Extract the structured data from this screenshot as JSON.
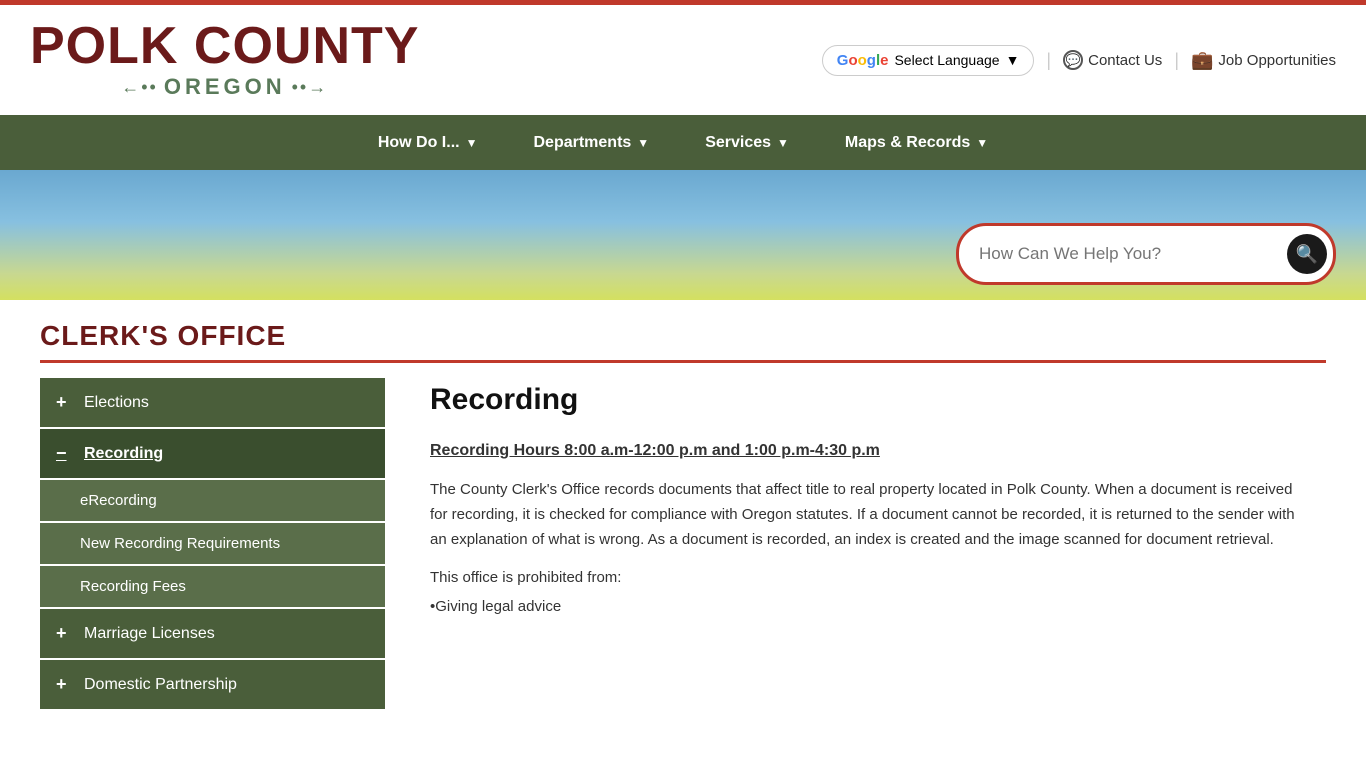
{
  "site": {
    "title_line1": "POLK COUNTY",
    "title_line2": "OREGON",
    "tagline_dots": "←••",
    "tagline_dots2": "••→"
  },
  "topbar": {
    "translate_label": "Select Language",
    "translate_arrow": "▼",
    "contact_label": "Contact Us",
    "jobs_label": "Job Opportunities",
    "separator": "|"
  },
  "nav": {
    "items": [
      {
        "label": "How Do I...",
        "arrow": "▼"
      },
      {
        "label": "Departments",
        "arrow": "▼"
      },
      {
        "label": "Services",
        "arrow": "▼"
      },
      {
        "label": "Maps & Records",
        "arrow": "▼"
      }
    ]
  },
  "hero": {
    "search_placeholder": "How Can We Help You?"
  },
  "page": {
    "section_title": "CLERK'S OFFICE"
  },
  "sidebar": {
    "items": [
      {
        "label": "Elections",
        "icon": "+",
        "expanded": false,
        "active": false
      },
      {
        "label": "Recording",
        "icon": "−",
        "expanded": true,
        "active": true
      },
      {
        "label": "Marriage Licenses",
        "icon": "+",
        "expanded": false,
        "active": false
      },
      {
        "label": "Domestic Partnership",
        "icon": "+",
        "expanded": false,
        "active": false
      }
    ],
    "sub_items": [
      {
        "label": "eRecording"
      },
      {
        "label": "New Recording Requirements"
      },
      {
        "label": "Recording Fees"
      }
    ]
  },
  "article": {
    "title": "Recording",
    "hours_link": "Recording Hours 8:00 a.m-12:00 p.m and 1:00 p.m-4:30 p.m",
    "paragraph1": "The County Clerk's Office records documents that affect title to real property located in Polk County. When a document is received for recording, it is checked for compliance with Oregon statutes. If a document cannot be recorded, it is returned to the sender with an explanation of what is wrong. As a document is recorded, an index is created and the image scanned for document retrieval.",
    "paragraph2": "This office is prohibited from:",
    "bullet1": "•Giving legal advice"
  }
}
